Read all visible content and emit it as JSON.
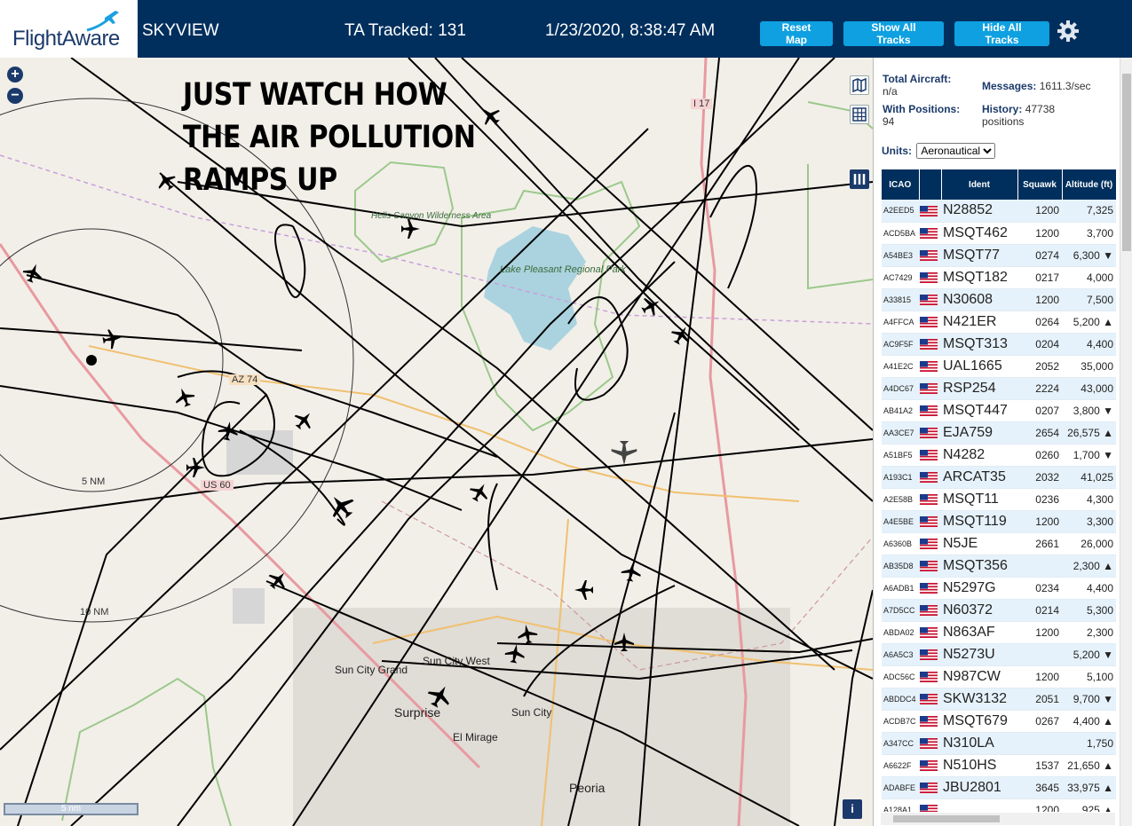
{
  "header": {
    "logo_text": "FlightAware",
    "app_title": "SKYVIEW",
    "tracked": "TA Tracked: 131",
    "datetime": "1/23/2020, 8:38:47 AM",
    "reset_label": "Reset Map",
    "show_label": "Show All Tracks",
    "hide_label": "Hide All Tracks",
    "settings_icon": "gear-icon"
  },
  "map": {
    "zoom_in": "+",
    "zoom_out": "−",
    "meme_line1": "JUST WATCH HOW",
    "meme_line2": "THE AIR POLLUTION",
    "meme_line3": "RAMPS UP",
    "labels": {
      "hells_canyon": "Hells Canyon Wilderness Area",
      "lake_pleasant": "Lake Pleasant Regional Park",
      "az74": "AZ 74",
      "us60": "US 60",
      "ring5": "5 NM",
      "ring10": "10 NM",
      "sun_city_grand": "Sun City Grand",
      "sun_city_west": "Sun City West",
      "surprise": "Surprise",
      "sun_city": "Sun City",
      "el_mirage": "El Mirage",
      "peoria": "Peoria",
      "i17": "I 17"
    },
    "scale_label": "5 nm",
    "info_label": "i",
    "colors": {
      "water": "#aad3df",
      "park": "#c8e0b4",
      "road": "#e89aa0",
      "track": "#000000"
    }
  },
  "panel": {
    "total_label": "Total Aircraft:",
    "total_value": "n/a",
    "positions_label": "With Positions:",
    "positions_value": "94",
    "messages_label": "Messages:",
    "messages_value": "1611.3/sec",
    "history_label": "History:",
    "history_value": "47738",
    "history_unit": "positions",
    "units_label": "Units:",
    "units_value": "Aeronautical",
    "columns": [
      "ICAO",
      "",
      "Ident",
      "Squawk",
      "Altitude (ft)"
    ],
    "rows": [
      {
        "icao": "A2EED5",
        "ident": "N28852",
        "squawk": "1200",
        "alt": "7,325"
      },
      {
        "icao": "ACD5BA",
        "ident": "MSQT462",
        "squawk": "1200",
        "alt": "3,700"
      },
      {
        "icao": "A54BE3",
        "ident": "MSQT77",
        "squawk": "0274",
        "alt": "6,300 ▼"
      },
      {
        "icao": "AC7429",
        "ident": "MSQT182",
        "squawk": "0217",
        "alt": "4,000"
      },
      {
        "icao": "A33815",
        "ident": "N30608",
        "squawk": "1200",
        "alt": "7,500"
      },
      {
        "icao": "A4FFCA",
        "ident": "N421ER",
        "squawk": "0264",
        "alt": "5,200 ▲"
      },
      {
        "icao": "AC9F5F",
        "ident": "MSQT313",
        "squawk": "0204",
        "alt": "4,400"
      },
      {
        "icao": "A41E2C",
        "ident": "UAL1665",
        "squawk": "2052",
        "alt": "35,000"
      },
      {
        "icao": "A4DC67",
        "ident": "RSP254",
        "squawk": "2224",
        "alt": "43,000"
      },
      {
        "icao": "AB41A2",
        "ident": "MSQT447",
        "squawk": "0207",
        "alt": "3,800 ▼"
      },
      {
        "icao": "AA3CE7",
        "ident": "EJA759",
        "squawk": "2654",
        "alt": "26,575 ▲"
      },
      {
        "icao": "A51BF5",
        "ident": "N4282",
        "squawk": "0260",
        "alt": "1,700 ▼"
      },
      {
        "icao": "A193C1",
        "ident": "ARCAT35",
        "squawk": "2032",
        "alt": "41,025"
      },
      {
        "icao": "A2E58B",
        "ident": "MSQT11",
        "squawk": "0236",
        "alt": "4,300"
      },
      {
        "icao": "A4E5BE",
        "ident": "MSQT119",
        "squawk": "1200",
        "alt": "3,300"
      },
      {
        "icao": "A6360B",
        "ident": "N5JE",
        "squawk": "2661",
        "alt": "26,000"
      },
      {
        "icao": "AB35D8",
        "ident": "MSQT356",
        "squawk": "",
        "alt": "2,300 ▲"
      },
      {
        "icao": "A6ADB1",
        "ident": "N5297G",
        "squawk": "0234",
        "alt": "4,400"
      },
      {
        "icao": "A7D5CC",
        "ident": "N60372",
        "squawk": "0214",
        "alt": "5,300"
      },
      {
        "icao": "ABDA02",
        "ident": "N863AF",
        "squawk": "1200",
        "alt": "2,300"
      },
      {
        "icao": "A6A5C3",
        "ident": "N5273U",
        "squawk": "",
        "alt": "5,200 ▼"
      },
      {
        "icao": "ADC56C",
        "ident": "N987CW",
        "squawk": "1200",
        "alt": "5,100"
      },
      {
        "icao": "ABDDC4",
        "ident": "SKW3132",
        "squawk": "2051",
        "alt": "9,700 ▼"
      },
      {
        "icao": "ACDB7C",
        "ident": "MSQT679",
        "squawk": "0267",
        "alt": "4,400 ▲"
      },
      {
        "icao": "A347CC",
        "ident": "N310LA",
        "squawk": "",
        "alt": "1,750"
      },
      {
        "icao": "A6622F",
        "ident": "N510HS",
        "squawk": "1537",
        "alt": "21,650 ▲"
      },
      {
        "icao": "ADABFE",
        "ident": "JBU2801",
        "squawk": "3645",
        "alt": "33,975 ▲"
      },
      {
        "icao": "A128A1",
        "ident": "",
        "squawk": "1200",
        "alt": "925 ▲"
      }
    ]
  }
}
